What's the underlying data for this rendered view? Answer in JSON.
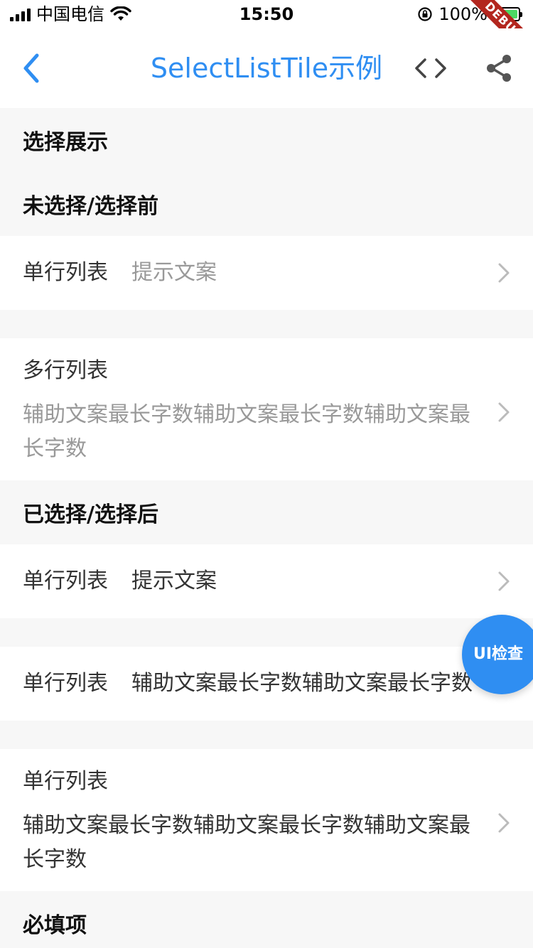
{
  "status_bar": {
    "carrier": "中国电信",
    "time": "15:50",
    "battery": "100%"
  },
  "debug_banner": "DEBUG",
  "nav": {
    "title": "SelectListTile示例"
  },
  "sections": {
    "display": "选择展示",
    "unselected": "未选择/选择前",
    "selected": "已选择/选择后",
    "required": "必填项"
  },
  "tiles": {
    "unselected_single": {
      "title": "单行列表",
      "value": "提示文案"
    },
    "unselected_multi": {
      "title": "多行列表",
      "value": "辅助文案最长字数辅助文案最长字数辅助文案最长字数"
    },
    "selected_single": {
      "title": "单行列表",
      "value": "提示文案"
    },
    "selected_single_long": {
      "title": "单行列表",
      "value": "辅助文案最长字数辅助文案最长字数"
    },
    "selected_multi": {
      "title": "单行列表",
      "value": "辅助文案最长字数辅助文案最长字数辅助文案最长字数"
    }
  },
  "fab": {
    "label": "UI检查"
  },
  "colors": {
    "accent": "#2f8ef2",
    "page_bg": "#f7f7f7",
    "hint_text": "#999999"
  }
}
